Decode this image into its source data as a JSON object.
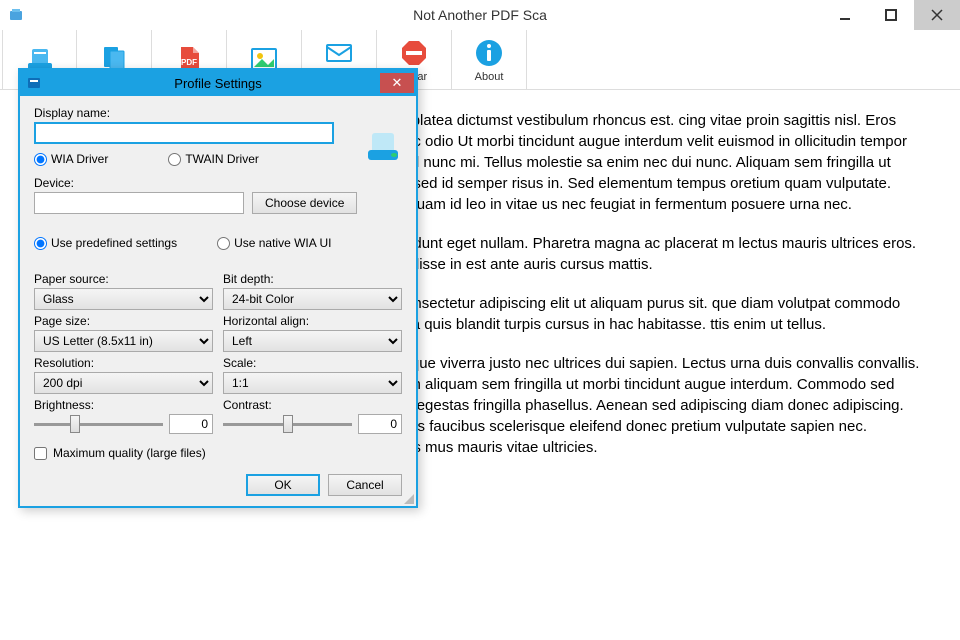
{
  "window": {
    "title": "Not Another PDF Sca",
    "controls": {
      "min": "–",
      "max": "◻",
      "close": "✕"
    }
  },
  "toolbar": {
    "items": [
      {
        "label": ""
      },
      {
        "label": ""
      },
      {
        "label": ""
      },
      {
        "label": ""
      },
      {
        "label": "PDF"
      },
      {
        "label": "Clear"
      },
      {
        "label": "About"
      }
    ]
  },
  "content": {
    "p1": "bitasse platea dictumst vestibulum rhoncus est. cing vitae proin sagittis nisl. Eros donec ac odio Ut morbi tincidunt augue interdum velit euismod in ollicitudin tempor id eu nisl nunc mi. Tellus molestie sa enim nec dui nunc. Aliquam sem fringilla ut morbi c sed id semper risus in. Sed elementum tempus oretium quam vulputate. Lectus quam id leo in vitae us nec feugiat in fermentum posuere urna nec.",
    "p2": "nisl tincidunt eget nullam. Pharetra magna ac placerat m lectus mauris ultrices eros. Suspendisse in est ante auris cursus mattis.",
    "p3": "amet consectetur adipiscing elit ut aliquam purus sit. que diam volutpat commodo sed. vida quis blandit turpis cursus in hac habitasse. ttis enim ut tellus.",
    "p4": "urna neque viverra justo nec ultrices dui sapien. Lectus urna duis convallis convallis. Mauris in aliquam sem fringilla ut morbi tincidunt augue interdum. Commodo sed egestas egestas fringilla phasellus. Aenean sed adipiscing diam donec adipiscing. Phasellus faucibus scelerisque eleifend donec pretium vulputate sapien nec. Ridiculus mus mauris vitae ultricies."
  },
  "dialog": {
    "title": "Profile Settings",
    "display_name_label": "Display name:",
    "display_name_value": "",
    "wia_label": "WIA Driver",
    "twain_label": "TWAIN Driver",
    "device_label": "Device:",
    "device_value": "",
    "choose_device": "Choose device",
    "predefined_label": "Use predefined settings",
    "native_label": "Use native WIA UI",
    "paper_source_label": "Paper source:",
    "paper_source_value": "Glass",
    "page_size_label": "Page size:",
    "page_size_value": "US Letter (8.5x11 in)",
    "resolution_label": "Resolution:",
    "resolution_value": "200 dpi",
    "brightness_label": "Brightness:",
    "brightness_value": "0",
    "bit_depth_label": "Bit depth:",
    "bit_depth_value": "24-bit Color",
    "halign_label": "Horizontal align:",
    "halign_value": "Left",
    "scale_label": "Scale:",
    "scale_value": "1:1",
    "contrast_label": "Contrast:",
    "contrast_value": "0",
    "max_quality_label": "Maximum quality (large files)",
    "ok": "OK",
    "cancel": "Cancel"
  }
}
